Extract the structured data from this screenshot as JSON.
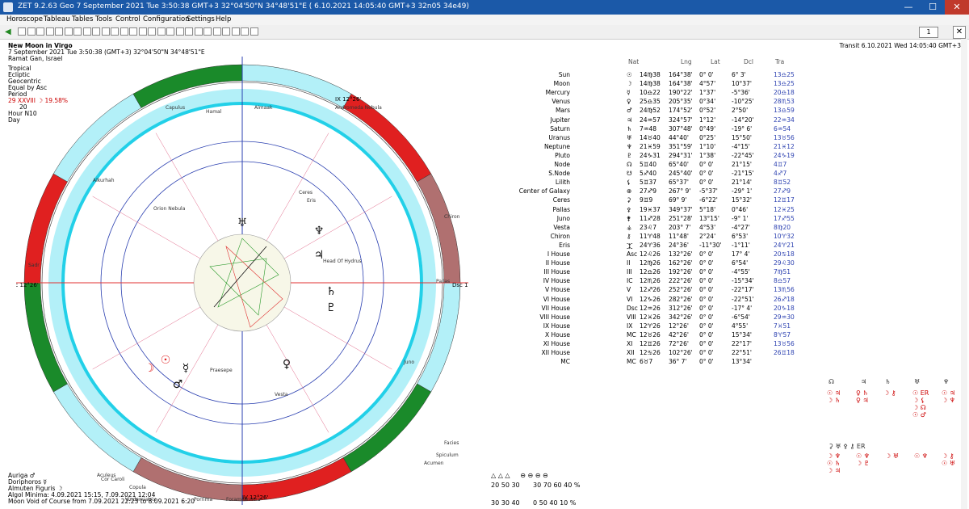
{
  "window": {
    "title": "ZET 9.2.63 Geo    7 September 2021  Tue   3:50:38 GMT+3 32°04'50\"N  34°48'51\"E   ( 6.10.2021  14:05:40 GMT+3 32n05 34e49)",
    "minimize": "—",
    "maximize": "☐",
    "close": "✕"
  },
  "menu": [
    "Horoscope",
    "Tableau",
    "Tables",
    "Tools",
    "Control",
    "Configuration",
    "Settings",
    "Help"
  ],
  "toolbar": {
    "page_number": "1"
  },
  "chart_info": {
    "title": "New Moon in Virgo",
    "date_line": "7 September 2021   Tue    3:50:38 (GMT+3) 32°04'50\"N  34°48'51\"E",
    "place": "Ramat Gan, Israel",
    "zodiac": "Tropical",
    "coords": "Ecliptic",
    "center": "Geocentric",
    "houses": "Equal by Asc",
    "period_label": "Period",
    "period_value": "29 XXVIII  ☽ 19.58%",
    "moon_value": "20",
    "hour_label": "Hour N10",
    "day_label": "Day"
  },
  "transit_header": "Transit  6.10.2021  Wed 14:05:40 GMT+3",
  "table": {
    "columns": {
      "nat": "Nat",
      "lng": "Lng",
      "lat": "Lat",
      "dcl": "Dcl",
      "tra": "Tra"
    },
    "rows": [
      {
        "name": "Sun",
        "sym": "☉",
        "lngs": "14♍38",
        "lng": "164°38'",
        "lat": "0° 0'",
        "dcl": "6° 3'",
        "tra": "13♎25"
      },
      {
        "name": "Moon",
        "sym": "☽",
        "lngs": "14♍38",
        "lng": "164°38'",
        "lat": "4°57'",
        "dcl": "10°37'",
        "tra": "13♎25"
      },
      {
        "name": "Mercury",
        "sym": "☿",
        "lngs": "10♎22",
        "lng": "190°22'",
        "lat": "1°37'",
        "dcl": "-5°36'",
        "tra": "20♎18"
      },
      {
        "name": "Venus",
        "sym": "♀",
        "lngs": "25♎35",
        "lng": "205°35'",
        "lat": "0°34'",
        "dcl": "-10°25'",
        "tra": "28♏53"
      },
      {
        "name": "Mars",
        "sym": "♂",
        "lngs": "24♍52",
        "lng": "174°52'",
        "lat": "0°52'",
        "dcl": "2°50'",
        "tra": "13♎59"
      },
      {
        "name": "Jupiter",
        "sym": "♃",
        "lngs": "24♒57",
        "lng": "324°57'",
        "lat": "1°12'",
        "dcl": "-14°20'",
        "tra": "22♒34"
      },
      {
        "name": "Saturn",
        "sym": "♄",
        "lngs": "7♒48",
        "lng": "307°48'",
        "lat": "0°49'",
        "dcl": "-19° 6'",
        "tra": "6♒54"
      },
      {
        "name": "Uranus",
        "sym": "♅",
        "lngs": "14♉40",
        "lng": "44°40'",
        "lat": "0°25'",
        "dcl": "15°50'",
        "tra": "13♉56"
      },
      {
        "name": "Neptune",
        "sym": "♆",
        "lngs": "21♓59",
        "lng": "351°59'",
        "lat": "1°10'",
        "dcl": "-4°15'",
        "tra": "21♓12"
      },
      {
        "name": "Pluto",
        "sym": "♇",
        "lngs": "24♑31",
        "lng": "294°31'",
        "lat": "1°38'",
        "dcl": "-22°45'",
        "tra": "24♑19"
      },
      {
        "name": "Node",
        "sym": "☊",
        "lngs": "5♊40",
        "lng": "65°40'",
        "lat": "0° 0'",
        "dcl": "21°15'",
        "tra": "4♊7"
      },
      {
        "name": "S.Node",
        "sym": "☋",
        "lngs": "5♐40",
        "lng": "245°40'",
        "lat": "0° 0'",
        "dcl": "-21°15'",
        "tra": "4♐7"
      },
      {
        "name": "Lilith",
        "sym": "⚸",
        "lngs": "5♊37",
        "lng": "65°37'",
        "lat": "0° 0'",
        "dcl": "21°14'",
        "tra": "8♊52"
      },
      {
        "name": "Center of Galaxy",
        "sym": "⊕",
        "lngs": "27♐9",
        "lng": "267° 9'",
        "lat": "-5°37'",
        "dcl": "-29° 1'",
        "tra": "27♐9"
      },
      {
        "name": "Ceres",
        "sym": "⚳",
        "lngs": "9♊9",
        "lng": "69° 9'",
        "lat": "-6°22'",
        "dcl": "15°32'",
        "tra": "12♊17"
      },
      {
        "name": "Pallas",
        "sym": "⚴",
        "lngs": "19♓37",
        "lng": "349°37'",
        "lat": "5°18'",
        "dcl": "0°46'",
        "tra": "12♓25"
      },
      {
        "name": "Juno",
        "sym": "⚵",
        "lngs": "11♐28",
        "lng": "251°28'",
        "lat": "13°15'",
        "dcl": "-9° 1'",
        "tra": "17♐55"
      },
      {
        "name": "Vesta",
        "sym": "⚶",
        "lngs": "23♌7",
        "lng": "203° 7'",
        "lat": "4°53'",
        "dcl": "-4°27'",
        "tra": "8♍20"
      },
      {
        "name": "Chiron",
        "sym": "⚷",
        "lngs": "11♈48",
        "lng": "11°48'",
        "lat": "2°24'",
        "dcl": "6°53'",
        "tra": "10♈32"
      },
      {
        "name": "Eris",
        "sym": "⯰",
        "lngs": "24♈36",
        "lng": "24°36'",
        "lat": "-11°30'",
        "dcl": "-1°11'",
        "tra": "24♈21"
      },
      {
        "name": "I House",
        "sym": "Asc",
        "lngs": "12♌26",
        "lng": "132°26'",
        "lat": "0° 0'",
        "dcl": "17° 4'",
        "tra": "20♋18"
      },
      {
        "name": "II House",
        "sym": "II",
        "lngs": "12♍26",
        "lng": "162°26'",
        "lat": "0° 0'",
        "dcl": "6°54'",
        "tra": "29♌30"
      },
      {
        "name": "III House",
        "sym": "III",
        "lngs": "12♎26",
        "lng": "192°26'",
        "lat": "0° 0'",
        "dcl": "-4°55'",
        "tra": "7♍51"
      },
      {
        "name": "IV House",
        "sym": "IC",
        "lngs": "12♏26",
        "lng": "222°26'",
        "lat": "0° 0'",
        "dcl": "-15°34'",
        "tra": "8♎57"
      },
      {
        "name": "V House",
        "sym": "V",
        "lngs": "12♐26",
        "lng": "252°26'",
        "lat": "0° 0'",
        "dcl": "-22°17'",
        "tra": "13♏56"
      },
      {
        "name": "VI House",
        "sym": "VI",
        "lngs": "12♑26",
        "lng": "282°26'",
        "lat": "0° 0'",
        "dcl": "-22°51'",
        "tra": "26♐18"
      },
      {
        "name": "VII House",
        "sym": "Dsc",
        "lngs": "12♒26",
        "lng": "312°26'",
        "lat": "0° 0'",
        "dcl": "-17° 4'",
        "tra": "20♑18"
      },
      {
        "name": "VIII House",
        "sym": "VIII",
        "lngs": "12♓26",
        "lng": "342°26'",
        "lat": "0° 0'",
        "dcl": "-6°54'",
        "tra": "29♒30"
      },
      {
        "name": "IX House",
        "sym": "IX",
        "lngs": "12♈26",
        "lng": "12°26'",
        "lat": "0° 0'",
        "dcl": "4°55'",
        "tra": "7♓51"
      },
      {
        "name": "X House",
        "sym": "MC",
        "lngs": "12♉26",
        "lng": "42°26'",
        "lat": "0° 0'",
        "dcl": "15°34'",
        "tra": "8♈57"
      },
      {
        "name": "XI House",
        "sym": "XI",
        "lngs": "12♊26",
        "lng": "72°26'",
        "lat": "0° 0'",
        "dcl": "22°17'",
        "tra": "13♉56"
      },
      {
        "name": "XII House",
        "sym": "XII",
        "lngs": "12♋26",
        "lng": "102°26'",
        "lat": "0° 0'",
        "dcl": "22°51'",
        "tra": "26♊18"
      },
      {
        "name": "MC",
        "sym": "MC",
        "lngs": "6♉7",
        "lng": "36° 7'",
        "lat": "0° 0'",
        "dcl": "13°34'",
        "tra": ""
      }
    ]
  },
  "wheel": {
    "asc_label": "Asc 12°26'",
    "dsc_label": "Dsc 12°26'",
    "mc_label": "IX 12°26'",
    "ic_label": "IV 12°26'",
    "inner_planets": [
      "☉",
      "☽",
      "☿",
      "♀",
      "♂",
      "♃",
      "♄",
      "♅",
      "♆",
      "♇"
    ],
    "stars": [
      "Capulus",
      "Hamal",
      "Almaak",
      "Andromeda Nebula",
      "Alkurhah",
      "Orion Nebula",
      "Ceres",
      "Eris",
      "Chiron",
      "Head Of Hydrus",
      "Pallas",
      "Sadr",
      "Praesepe",
      "Vesta",
      "Juno",
      "Facies",
      "Spiculum",
      "Acumen",
      "Aculeus",
      "Cor Caroli",
      "Copula",
      "Vindemiatrix",
      "Porrima",
      "Foramen",
      "Sinistra",
      "Deneb Algedi"
    ]
  },
  "bottom": {
    "line1": "Auriga  ♂",
    "line2": "Doriphoros  ☿",
    "line3": "Almuten Figuris  ☽",
    "line4": "Algol Minima: 4.09.2021 15:15, 7.09.2021 12:04",
    "line5": "Moon Void of Course from 7.09.2021 22:23 to 8.09.2021  6:20"
  },
  "elements": {
    "row1": "20  50  30",
    "row2": "30  70  60  40 %",
    "row3": "30  30  40",
    "row4": "0  50  40  10 %"
  },
  "colors": {
    "title_bar": "#1b59a8",
    "ring_red": "#e02020",
    "ring_green": "#1a8a2a",
    "ring_brown": "#b07070",
    "ring_cyan": "#b3f0f8",
    "inner_cyan": "#22d0e8"
  }
}
